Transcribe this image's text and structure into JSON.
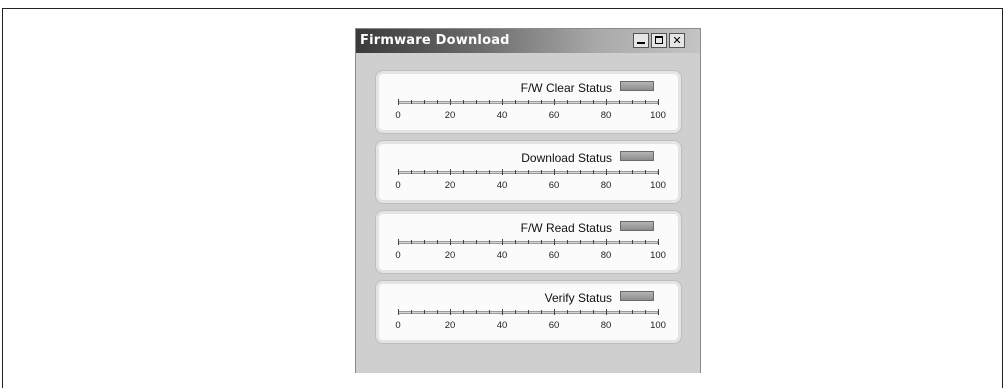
{
  "window": {
    "title": "Firmware Download",
    "controls": {
      "minimize_icon": "minimize-icon",
      "maximize_icon": "maximize-icon",
      "close_icon": "close-icon",
      "close_glyph": "✕"
    }
  },
  "scale_labels": [
    "0",
    "20",
    "40",
    "60",
    "80",
    "100"
  ],
  "panels": [
    {
      "label": "F/W Clear Status",
      "progress": 0,
      "indicator_color": "#9a9a9a"
    },
    {
      "label": "Download Status",
      "progress": 0,
      "indicator_color": "#9a9a9a"
    },
    {
      "label": "F/W Read Status",
      "progress": 0,
      "indicator_color": "#9a9a9a"
    },
    {
      "label": "Verify Status",
      "progress": 0,
      "indicator_color": "#9a9a9a"
    }
  ]
}
